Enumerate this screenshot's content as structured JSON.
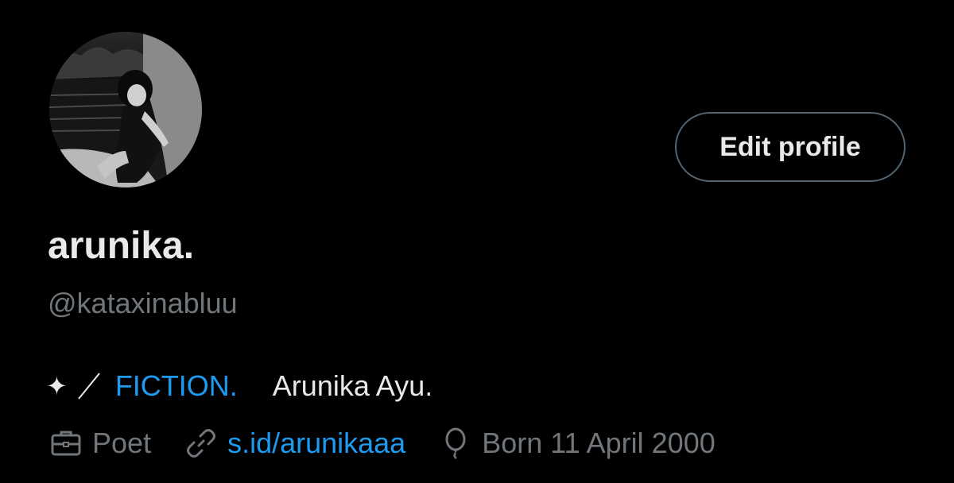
{
  "profile": {
    "display_name": "arunika.",
    "handle": "@kataxinabluu",
    "edit_button_label": "Edit profile"
  },
  "bio": {
    "sparkle": "✦",
    "fiction": "FICTION.",
    "name": "Arunika Ayu."
  },
  "meta": {
    "profession": "Poet",
    "link": "s.id/arunikaaa",
    "birthday": "Born 11 April 2000"
  },
  "icons": {
    "profession": "briefcase-icon",
    "link": "link-icon",
    "birthday": "balloon-icon"
  },
  "colors": {
    "background": "#000000",
    "text_primary": "#e7e9ea",
    "text_secondary": "#71767b",
    "accent": "#1d9bf0",
    "button_border": "#536471"
  }
}
